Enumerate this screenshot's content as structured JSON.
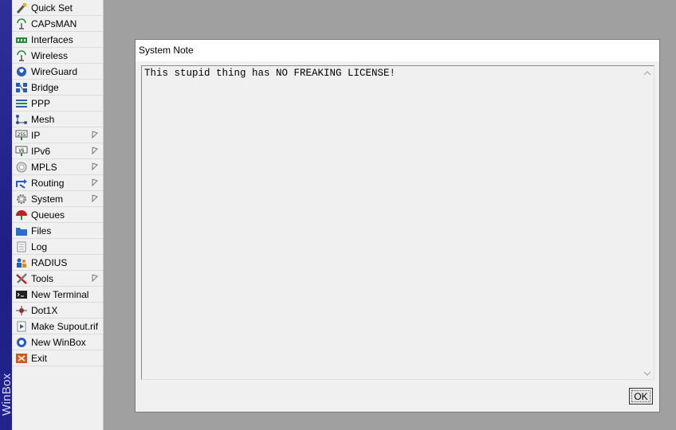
{
  "brand": {
    "text": "WinBox"
  },
  "menu": [
    {
      "label": "Quick Set",
      "icon": "wand-icon",
      "submenu": false
    },
    {
      "label": "CAPsMAN",
      "icon": "antenna-icon",
      "submenu": false
    },
    {
      "label": "Interfaces",
      "icon": "interfaces-icon",
      "submenu": false
    },
    {
      "label": "Wireless",
      "icon": "wireless-icon",
      "submenu": false
    },
    {
      "label": "WireGuard",
      "icon": "wireguard-icon",
      "submenu": false
    },
    {
      "label": "Bridge",
      "icon": "bridge-icon",
      "submenu": false
    },
    {
      "label": "PPP",
      "icon": "ppp-icon",
      "submenu": false
    },
    {
      "label": "Mesh",
      "icon": "mesh-icon",
      "submenu": false
    },
    {
      "label": "IP",
      "icon": "ip-icon",
      "submenu": true
    },
    {
      "label": "IPv6",
      "icon": "ipv6-icon",
      "submenu": true
    },
    {
      "label": "MPLS",
      "icon": "mpls-icon",
      "submenu": true
    },
    {
      "label": "Routing",
      "icon": "routing-icon",
      "submenu": true
    },
    {
      "label": "System",
      "icon": "system-icon",
      "submenu": true
    },
    {
      "label": "Queues",
      "icon": "queues-icon",
      "submenu": false
    },
    {
      "label": "Files",
      "icon": "files-icon",
      "submenu": false
    },
    {
      "label": "Log",
      "icon": "log-icon",
      "submenu": false
    },
    {
      "label": "RADIUS",
      "icon": "radius-icon",
      "submenu": false
    },
    {
      "label": "Tools",
      "icon": "tools-icon",
      "submenu": true
    },
    {
      "label": "New Terminal",
      "icon": "terminal-icon",
      "submenu": false
    },
    {
      "label": "Dot1X",
      "icon": "dot1x-icon",
      "submenu": false
    },
    {
      "label": "Make Supout.rif",
      "icon": "supout-icon",
      "submenu": false
    },
    {
      "label": "New WinBox",
      "icon": "winbox-icon",
      "submenu": false
    },
    {
      "label": "Exit",
      "icon": "exit-icon",
      "submenu": false
    }
  ],
  "dialog": {
    "title": "System Note",
    "note": "This stupid thing has NO FREAKING LICENSE!",
    "ok_label": "OK"
  },
  "colors": {
    "desktop": "#a0a0a0",
    "brand_strip": "#23238c",
    "panel": "#f0f0f0"
  }
}
